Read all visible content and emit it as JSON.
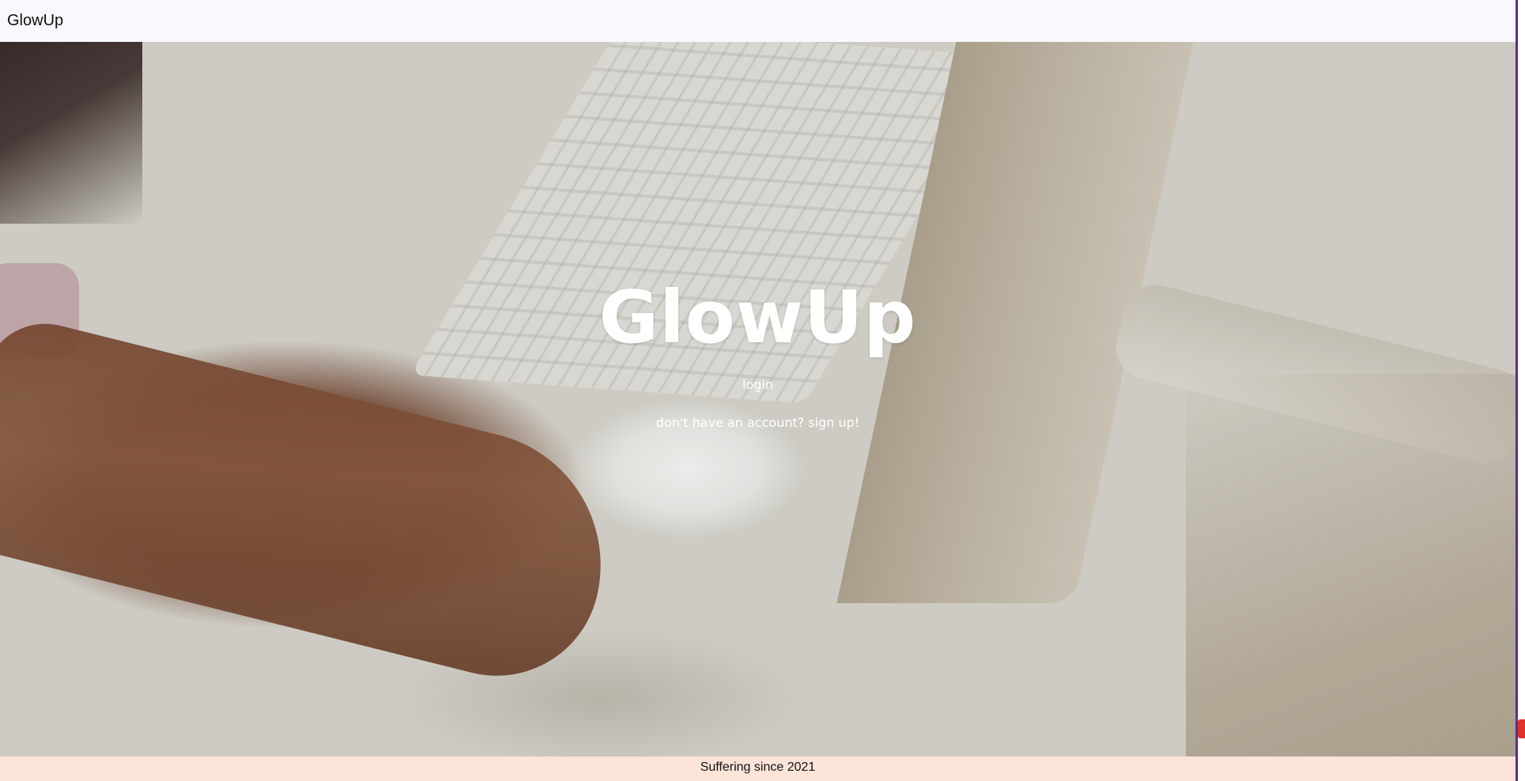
{
  "navbar": {
    "brand": "GlowUp"
  },
  "hero": {
    "title": "GlowUp",
    "login_label": "login",
    "signup_label": "don't have an account? sign up!"
  },
  "footer": {
    "text": "Suffering since 2021"
  },
  "colors": {
    "navbar_bg": "#f8f9fc",
    "footer_bg": "#fde4d8",
    "hero_text": "#ffffff"
  }
}
